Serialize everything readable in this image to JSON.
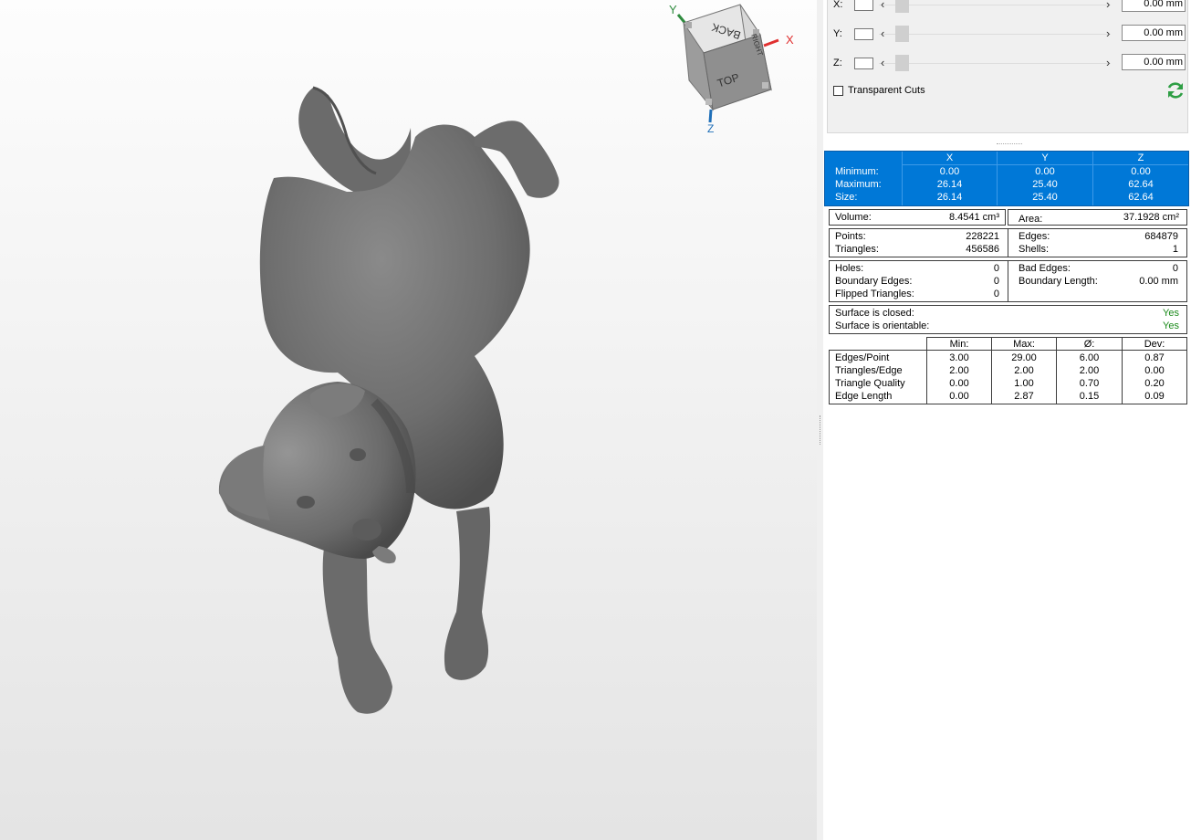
{
  "cut": {
    "rows": [
      {
        "axis": "X:",
        "value": "0.00 mm"
      },
      {
        "axis": "Y:",
        "value": "0.00 mm"
      },
      {
        "axis": "Z:",
        "value": "0.00 mm"
      }
    ],
    "transparent_label": "Transparent Cuts"
  },
  "viewcube": {
    "faces": {
      "top": "TOP",
      "back": "BACK",
      "right": "RIGHT"
    },
    "axes": {
      "x": "X",
      "y": "Y",
      "z": "Z"
    },
    "colors": {
      "x": "#e03030",
      "y": "#2e8b3e",
      "z": "#1f6fb8"
    }
  },
  "bbox": {
    "headers": [
      "X",
      "Y",
      "Z"
    ],
    "rows": [
      {
        "label": "Minimum:",
        "values": [
          "0.00",
          "0.00",
          "0.00"
        ]
      },
      {
        "label": "Maximum:",
        "values": [
          "26.14",
          "25.40",
          "62.64"
        ]
      },
      {
        "label": "Size:",
        "values": [
          "26.14",
          "25.40",
          "62.64"
        ]
      }
    ]
  },
  "volume": {
    "label": "Volume:",
    "value": "8.4541 cm³"
  },
  "area": {
    "label": "Area:",
    "value": "37.1928 cm²"
  },
  "mesh": {
    "points_label": "Points:",
    "points": "228221",
    "triangles_label": "Triangles:",
    "triangles": "456586",
    "edges_label": "Edges:",
    "edges": "684879",
    "shells_label": "Shells:",
    "shells": "1"
  },
  "errors": {
    "holes_label": "Holes:",
    "holes": "0",
    "boundary_edges_label": "Boundary Edges:",
    "boundary_edges": "0",
    "flipped_label": "Flipped Triangles:",
    "flipped": "0",
    "bad_edges_label": "Bad Edges:",
    "bad_edges": "0",
    "boundary_length_label": "Boundary Length:",
    "boundary_length": "0.00 mm"
  },
  "surface": {
    "closed_label": "Surface is closed:",
    "closed": "Yes",
    "orientable_label": "Surface is orientable:",
    "orientable": "Yes",
    "yes_color": "#1a8a1a"
  },
  "stats": {
    "headers": [
      "Min:",
      "Max:",
      "Ø:",
      "Dev:"
    ],
    "rows": [
      {
        "label": "Edges/Point",
        "values": [
          "3.00",
          "29.00",
          "6.00",
          "0.87"
        ]
      },
      {
        "label": "Triangles/Edge",
        "values": [
          "2.00",
          "2.00",
          "2.00",
          "0.00"
        ]
      },
      {
        "label": "Triangle Quality",
        "values": [
          "0.00",
          "1.00",
          "0.70",
          "0.20"
        ]
      },
      {
        "label": "Edge Length",
        "values": [
          "0.00",
          "2.87",
          "0.15",
          "0.09"
        ]
      }
    ]
  },
  "colors": {
    "selection": "#0078d7",
    "model": "#6e6e6e",
    "refresh": "#2e9e44"
  }
}
